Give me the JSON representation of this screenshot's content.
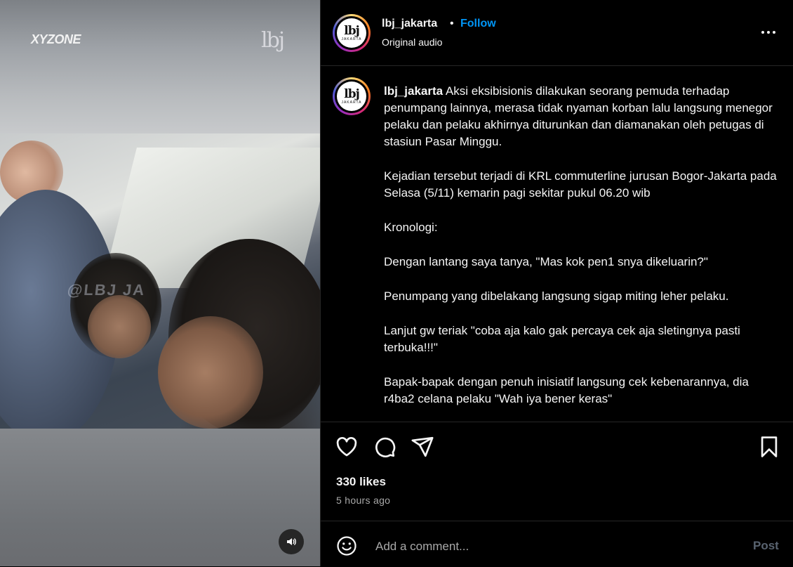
{
  "media": {
    "logo_left": "XYZONE",
    "logo_right": "lbj",
    "watermark": "@LBJ JA",
    "audio_icon": "speaker-icon"
  },
  "header": {
    "username": "lbj_jakarta",
    "separator": "•",
    "follow_label": "Follow",
    "audio_label": "Original audio",
    "avatar_mark": "lbj",
    "avatar_sub": "JAKARTA",
    "more_icon": "more-horizontal-icon"
  },
  "caption": {
    "username": "lbj_jakarta",
    "paragraphs": [
      "Aksi eksibisionis dilakukan seorang pemuda terhadap penumpang lainnya, merasa tidak nyaman korban lalu langsung menegor pelaku dan pelaku akhirnya diturunkan dan diamanakan oleh petugas di stasiun Pasar Minggu.",
      "Kejadian tersebut terjadi di KRL commuterline jurusan Bogor-Jakarta pada Selasa (5/11) kemarin pagi sekitar pukul 06.20 wib",
      "Kronologi:",
      "Dengan lantang saya tanya, \"Mas kok pen1 snya dikeluarin?\"",
      "Penumpang yang dibelakang langsung sigap miting leher pelaku.",
      "Lanjut gw teriak \"coba aja kalo gak percaya cek aja sletingnya pasti terbuka!!!\"",
      "Bapak-bapak dengan penuh inisiatif langsung cek kebenarannya, dia r4ba2 celana pelaku \"Wah iya bener keras\""
    ]
  },
  "actions": {
    "icons": [
      "heart-icon",
      "comment-icon",
      "share-icon",
      "bookmark-icon"
    ]
  },
  "stats": {
    "likes": "330 likes",
    "time": "5 hours ago"
  },
  "comment": {
    "placeholder": "Add a comment...",
    "post_label": "Post",
    "emoji_icon": "emoji-icon"
  },
  "colors": {
    "background": "#000000",
    "text": "#f5f5f5",
    "follow": "#0095f6",
    "muted": "#a8a8a8",
    "post_disabled": "#596370",
    "divider": "#262626"
  }
}
